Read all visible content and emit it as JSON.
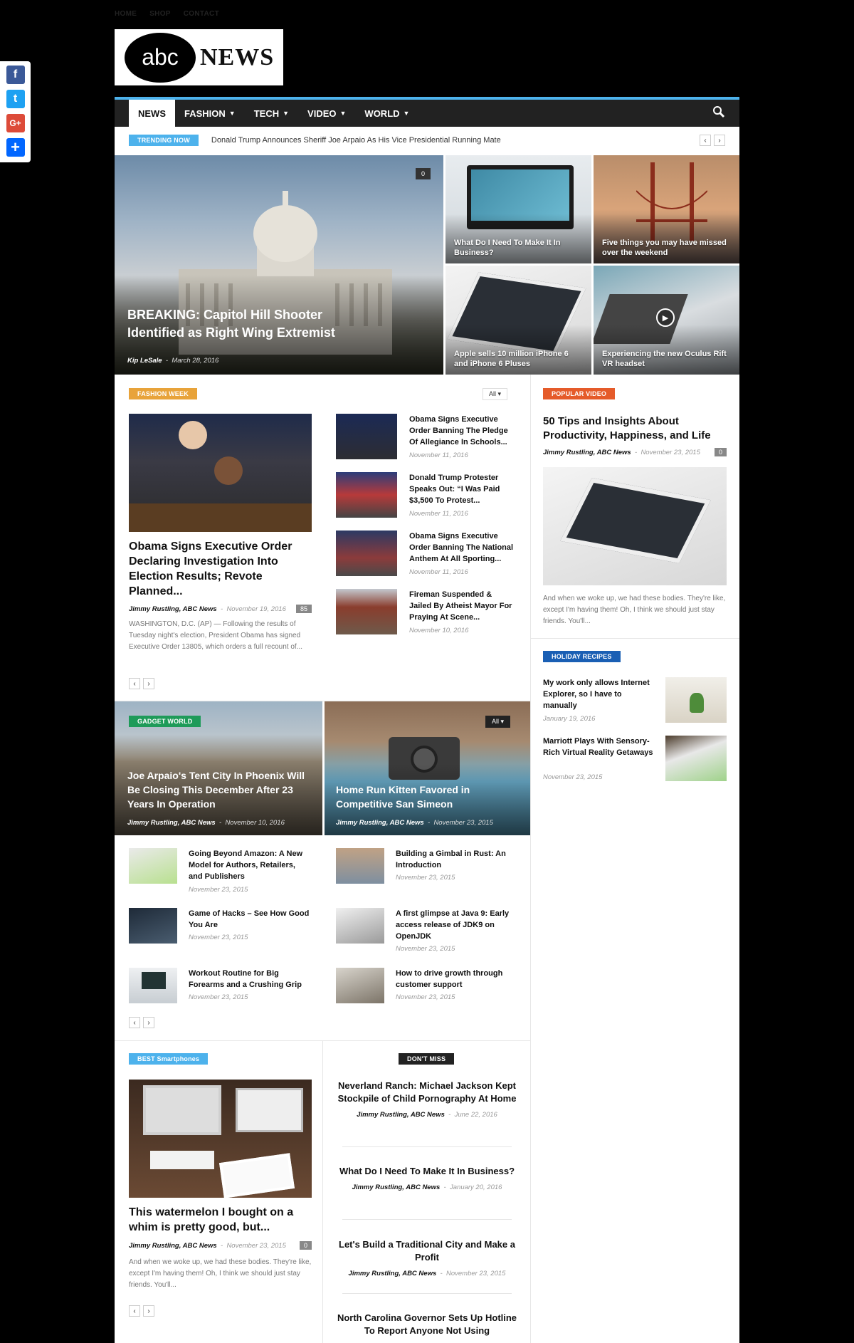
{
  "topmenu": [
    "HOME",
    "SHOP",
    "CONTACT"
  ],
  "logo": {
    "abc": "abc",
    "news": "NEWS"
  },
  "social": [
    "f",
    "t",
    "G+",
    "+"
  ],
  "nav": {
    "items": [
      "NEWS",
      "FASHION",
      "TECH",
      "VIDEO",
      "WORLD"
    ]
  },
  "trending": {
    "label": "TRENDING NOW",
    "headline": "Donald Trump Announces Sheriff Joe Arpaio As His Vice Presidential Running Mate"
  },
  "hero": {
    "main": {
      "title": "BREAKING: Capitol Hill Shooter Identified as Right Wing Extremist",
      "author": "Kip LeSale",
      "date": "March 28, 2016",
      "comments": "0"
    },
    "tiles": [
      "What Do I Need To Make It In Business?",
      "Five things you may have missed over the weekend",
      "Apple sells 10 million iPhone 6 and iPhone 6 Pluses",
      "Experiencing the new Oculus Rift VR headset"
    ]
  },
  "fashion": {
    "label": "FASHION WEEK",
    "filter": "All",
    "main": {
      "title": "Obama Signs Executive Order Declaring Investigation Into Election Results; Revote Planned...",
      "author": "Jimmy Rustling, ABC News",
      "date": "November 19, 2016",
      "comments": "85",
      "excerpt": "WASHINGTON, D.C. (AP) — Following the results of Tuesday night's election, President Obama has signed Executive Order 13805, which orders a full recount of..."
    },
    "list": [
      {
        "title": "Obama Signs Executive Order Banning The Pledge Of Allegiance In Schools...",
        "date": "November 11, 2016"
      },
      {
        "title": "Donald Trump Protester Speaks Out: “I Was Paid $3,500 To Protest...",
        "date": "November 11, 2016"
      },
      {
        "title": "Obama Signs Executive Order Banning The National Anthem At All Sporting...",
        "date": "November 11, 2016"
      },
      {
        "title": "Fireman Suspended & Jailed By Atheist Mayor For Praying At Scene...",
        "date": "November 10, 2016"
      }
    ]
  },
  "popular": {
    "label": "POPULAR VIDEO",
    "title": "50 Tips and Insights About Productivity, Happiness, and Life",
    "author": "Jimmy Rustling, ABC News",
    "date": "November 23, 2015",
    "comments": "0",
    "excerpt": "And when we woke up, we had these bodies. They're like, except I'm having them! Oh, I think we should just stay friends. You'll..."
  },
  "holiday": {
    "label": "HOLIDAY RECIPES",
    "items": [
      {
        "title": "My work only allows Internet Explorer, so I have to manually",
        "date": "January 19, 2016"
      },
      {
        "title": "Marriott Plays With Sensory-Rich Virtual Reality Getaways",
        "date": "November 23, 2015"
      }
    ]
  },
  "gadget": {
    "label": "GADGET WORLD",
    "filter": "All",
    "left": {
      "title": "Joe Arpaio's Tent City In Phoenix Will Be Closing This December After 23 Years In Operation",
      "author": "Jimmy Rustling, ABC News",
      "date": "November 10, 2016"
    },
    "right": {
      "title": "Home Run Kitten Favored in Competitive San Simeon",
      "author": "Jimmy Rustling, ABC News",
      "date": "November 23, 2015"
    },
    "list": [
      {
        "title": "Going Beyond Amazon: A New Model for Authors, Retailers, and Publishers",
        "date": "November 23, 2015"
      },
      {
        "title": "Building a Gimbal in Rust: An Introduction",
        "date": "November 23, 2015"
      },
      {
        "title": "Game of Hacks – See How Good You Are",
        "date": "November 23, 2015"
      },
      {
        "title": "A first glimpse at Java 9: Early access release of JDK9 on OpenJDK",
        "date": "November 23, 2015"
      },
      {
        "title": "Workout Routine for Big Forearms and a Crushing Grip",
        "date": "November 23, 2015"
      },
      {
        "title": "How to drive growth through customer support",
        "date": "November 23, 2015"
      }
    ]
  },
  "smart": {
    "label": "BEST Smartphones",
    "title": "This watermelon I bought on a whim is pretty good, but...",
    "author": "Jimmy Rustling, ABC News",
    "date": "November 23, 2015",
    "comments": "0",
    "excerpt": "And when we woke up, we had these bodies. They're like, except I'm having them! Oh, I think we should just stay friends. You'll..."
  },
  "dontmiss": {
    "label": "DON'T MISS",
    "items": [
      {
        "title": "Neverland Ranch: Michael Jackson Kept Stockpile of Child Pornography At Home",
        "author": "Jimmy Rustling, ABC News",
        "date": "June 22, 2016"
      },
      {
        "title": "What Do I Need To Make It In Business?",
        "author": "Jimmy Rustling, ABC News",
        "date": "January 20, 2016"
      },
      {
        "title": "Let's Build a Traditional City and Make a Profit",
        "author": "Jimmy Rustling, ABC News",
        "date": "November 23, 2015"
      },
      {
        "title": "North Carolina Governor Sets Up Hotline To Report Anyone Not Using"
      }
    ]
  },
  "colors": {
    "accent": "#4db2ec",
    "fashion": "#e8a33a",
    "popular": "#e55b2a",
    "holiday": "#1a5fb4",
    "gadget": "#1e9b59",
    "smart": "#4db2ec"
  }
}
